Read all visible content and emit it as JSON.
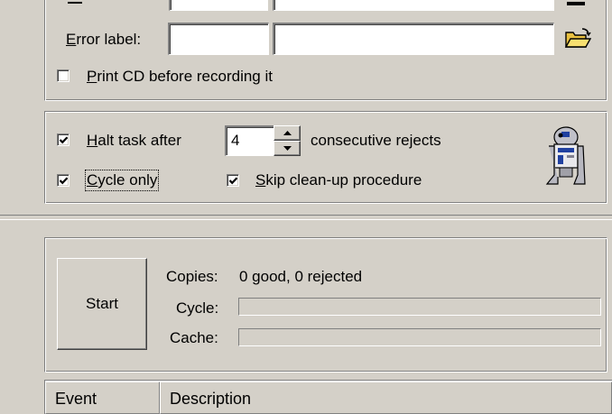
{
  "error_label": {
    "label_rest": "rror label:",
    "label_mnemonic": "E",
    "code_value": "",
    "path_value": ""
  },
  "print_cd": {
    "checked": false,
    "mnemonic": "P",
    "label_rest": "rint CD before recording it"
  },
  "halt_task": {
    "checked": true,
    "mnemonic": "H",
    "label_rest": "alt task after",
    "count": "4",
    "suffix": "consecutive rejects"
  },
  "cycle_only": {
    "checked": true,
    "mnemonic": "C",
    "label_rest": "ycle only"
  },
  "skip_cleanup": {
    "checked": true,
    "mnemonic": "S",
    "label_rest": "kip clean-up procedure"
  },
  "start_button": "Start",
  "status": {
    "copies_label": "Copies:",
    "copies_value": "0 good, 0 rejected",
    "cycle_label": "Cycle:",
    "cache_label": "Cache:",
    "cycle_progress": 0,
    "cache_progress": 0
  },
  "event_table": {
    "columns": [
      "Event",
      "Description"
    ]
  },
  "icons": {
    "folder": "open-folder-icon",
    "robot": "robot-icon"
  }
}
